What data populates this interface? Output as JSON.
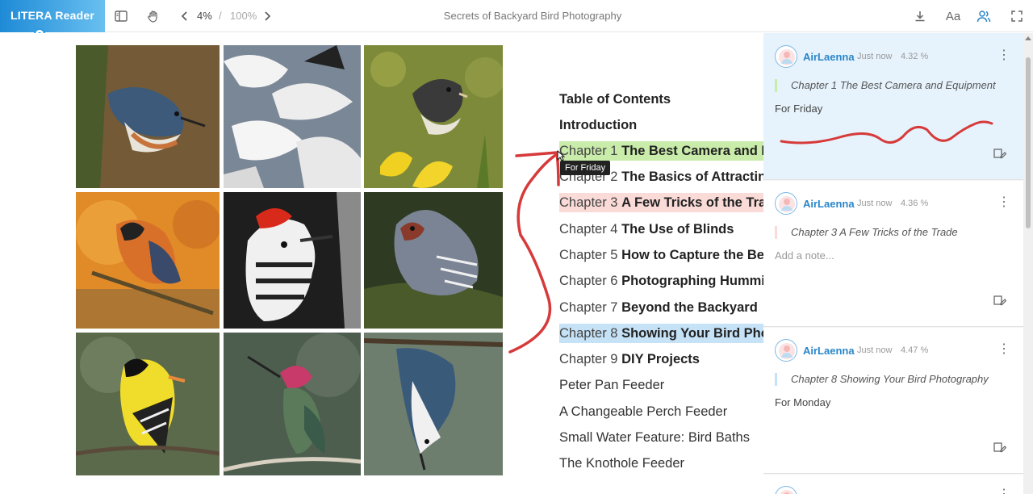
{
  "app": {
    "brand": "LITERA Reader",
    "document_title": "Secrets of Backyard Bird Photography",
    "page_position": "4%",
    "page_slash": "/",
    "page_total": "100%"
  },
  "toolbar": {
    "left_icons": [
      "sidebar-toggle-icon",
      "hand-pan-icon",
      "chevron-left-icon",
      "chevron-right-icon"
    ],
    "right_icons": [
      "download-icon",
      "font-size-icon",
      "users-icon",
      "fullscreen-icon"
    ],
    "font_glyph": "Aa"
  },
  "colors": {
    "brand_start": "#1e8ad6",
    "brand_end": "#69c0f0",
    "highlight_green": "#c9ecaa",
    "highlight_red": "#fadbd8",
    "highlight_blue": "#c5e2f7",
    "annotation_stroke": "#d63a3a",
    "username": "#2a86c9"
  },
  "toc": {
    "heading": "Table of Contents",
    "items": [
      {
        "num": "",
        "title": "Introduction"
      },
      {
        "num": "Chapter 1",
        "title": "The Best Camera and Equi"
      },
      {
        "num": "Chapter 2",
        "title": "The Basics of Attracting Bi"
      },
      {
        "num": "Chapter 3",
        "title": "A Few Tricks of the Trade"
      },
      {
        "num": "Chapter 4",
        "title": "The Use of Blinds"
      },
      {
        "num": "Chapter 5",
        "title": "How to Capture the Best B"
      },
      {
        "num": "Chapter 6",
        "title": "Photographing Humming"
      },
      {
        "num": "Chapter 7",
        "title": "Beyond the Backyard"
      },
      {
        "num": "Chapter 8",
        "title": "Showing Your Bird Photog"
      },
      {
        "num": "Chapter 9",
        "title": "DIY Projects"
      },
      {
        "num": "",
        "title": "Peter Pan Feeder"
      },
      {
        "num": "",
        "title": "A Changeable Perch Feeder"
      },
      {
        "num": "",
        "title": "Small Water Feature: Bird Baths"
      },
      {
        "num": "",
        "title": "The Knothole Feeder"
      }
    ],
    "tooltip": "For Friday"
  },
  "annotations": [
    {
      "user": "AirLaenna",
      "time": "Just now",
      "percent": "4.32 %",
      "quote": "Chapter 1 The Best Camera and Equipment",
      "note": "For Friday",
      "color": "green"
    },
    {
      "user": "AirLaenna",
      "time": "Just now",
      "percent": "4.36 %",
      "quote": "Chapter 3 A Few Tricks of the Trade",
      "note": "Add a note...",
      "color": "red"
    },
    {
      "user": "AirLaenna",
      "time": "Just now",
      "percent": "4.47 %",
      "quote": "Chapter 8 Showing Your Bird Photography",
      "note": "For Monday",
      "color": "blue"
    }
  ],
  "photos": [
    {
      "name": "nuthatch-photo",
      "bg": "#6b5a3a"
    },
    {
      "name": "snow-geese-photo",
      "bg": "#8a94a0"
    },
    {
      "name": "junco-daffodil-photo",
      "bg": "#8a8f3a"
    },
    {
      "name": "oriole-photo",
      "bg": "#e0902a"
    },
    {
      "name": "woodpecker-photo",
      "bg": "#2a2a2a"
    },
    {
      "name": "quail-dove-photo",
      "bg": "#3b4a2a"
    },
    {
      "name": "goldfinch-photo",
      "bg": "#6a7a5a"
    },
    {
      "name": "hummingbird-photo",
      "bg": "#5a6a5a"
    },
    {
      "name": "nuthatch-hanging-photo",
      "bg": "#7a8a7a"
    }
  ]
}
